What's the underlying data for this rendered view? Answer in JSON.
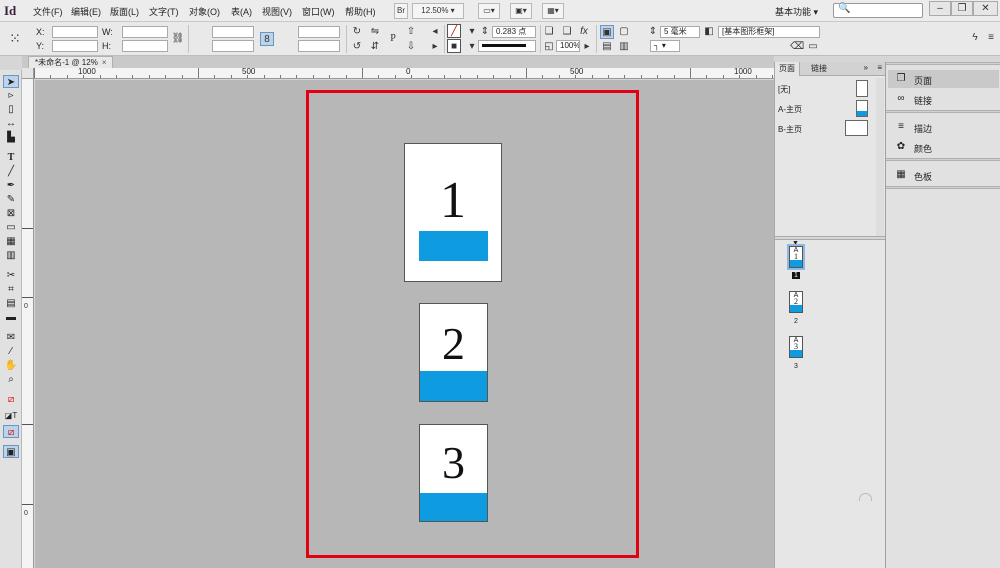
{
  "menubar": {
    "logo": "Id",
    "items": [
      "文件(F)",
      "编辑(E)",
      "版面(L)",
      "文字(T)",
      "对象(O)",
      "表(A)",
      "视图(V)",
      "窗口(W)",
      "帮助(H)"
    ],
    "bridge_label": "Br",
    "zoom": "12.50%",
    "workspace": "基本功能",
    "search_icon": "🔍"
  },
  "controlbar": {
    "x_label": "X:",
    "y_label": "Y:",
    "w_label": "W:",
    "h_label": "H:",
    "stroke_weight": "0.283 点",
    "opacity": "100%",
    "corner_size": "5 毫米",
    "style": "[基本图形框架]"
  },
  "document_tab": {
    "title": "*未命名-1 @ 12%",
    "close": "×"
  },
  "rulers": {
    "horizontal_labels": [
      "1000",
      "500",
      "0",
      "500",
      "1000"
    ],
    "vertical_labels": [
      "0",
      "0"
    ]
  },
  "canvas_pages": [
    {
      "number": "1"
    },
    {
      "number": "2"
    },
    {
      "number": "3"
    }
  ],
  "pages_panel": {
    "tabs": [
      "页面",
      "链接"
    ],
    "arrows": "»",
    "menu": "≡",
    "masters": [
      "[无]",
      "A-主页",
      "B-主页"
    ],
    "thumbnails": [
      {
        "master": "A",
        "number": "1",
        "caption": "1"
      },
      {
        "master": "A",
        "number": "2",
        "caption": "2"
      },
      {
        "master": "A",
        "number": "3",
        "caption": "3"
      }
    ]
  },
  "right_dock": {
    "items": [
      {
        "label": "页面",
        "icon": "pages-icon"
      },
      {
        "label": "链接",
        "icon": "links-icon"
      },
      {
        "label": "描边",
        "icon": "stroke-icon"
      },
      {
        "label": "颜色",
        "icon": "color-icon"
      },
      {
        "label": "色板",
        "icon": "swatches-icon"
      }
    ]
  },
  "colors": {
    "accent_blue": "#0f9be0",
    "highlight_red": "#e20012",
    "canvas_gray": "#b7b7b7"
  }
}
